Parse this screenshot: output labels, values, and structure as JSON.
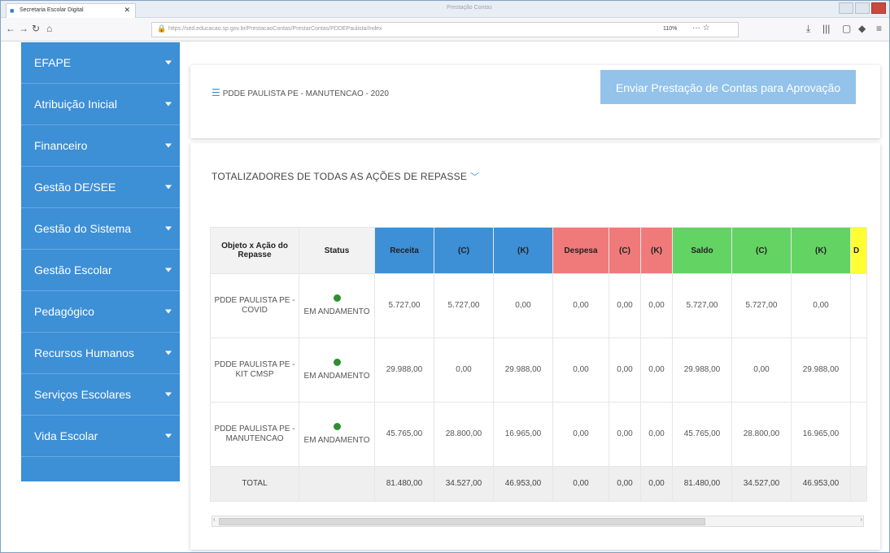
{
  "browser": {
    "tab_title": "Secretaria Escolar Digital",
    "window_title": "Prestação Contas",
    "url": "https://sed.educacao.sp.gov.br/PrestacaoContas/PrestarContas/PDDEPaulista/Index",
    "zoom": "110%"
  },
  "sidebar": {
    "items": [
      {
        "label": "EFAPE"
      },
      {
        "label": "Atribuição Inicial"
      },
      {
        "label": "Financeiro"
      },
      {
        "label": "Gestão DE/SEE"
      },
      {
        "label": "Gestão do Sistema"
      },
      {
        "label": "Gestão Escolar"
      },
      {
        "label": "Pedagógico"
      },
      {
        "label": "Recursos Humanos"
      },
      {
        "label": "Serviços Escolares"
      },
      {
        "label": "Vida Escolar"
      }
    ]
  },
  "header_card": {
    "title": "PDDE PAULISTA PE - MANUTENCAO - 2020",
    "send_button": "Enviar Prestação de Contas para Aprovação"
  },
  "totals": {
    "section_title": "TOTALIZADORES DE TODAS AS AÇÕES DE REPASSE",
    "columns": [
      "Objeto x Ação do Repasse",
      "Status",
      "Receita",
      "(C)",
      "(K)",
      "Despesa",
      "(C)",
      "(K)",
      "Saldo",
      "(C)",
      "(K)",
      "D"
    ],
    "rows": [
      {
        "objeto": "PDDE PAULISTA PE - COVID",
        "status": "EM ANDAMENTO",
        "receita": "5.727,00",
        "receita_c": "5.727,00",
        "receita_k": "0,00",
        "despesa": "0,00",
        "despesa_c": "0,00",
        "despesa_k": "0,00",
        "saldo": "5.727,00",
        "saldo_c": "5.727,00",
        "saldo_k": "0,00"
      },
      {
        "objeto": "PDDE PAULISTA PE - KIT CMSP",
        "status": "EM ANDAMENTO",
        "receita": "29.988,00",
        "receita_c": "0,00",
        "receita_k": "29.988,00",
        "despesa": "0,00",
        "despesa_c": "0,00",
        "despesa_k": "0,00",
        "saldo": "29.988,00",
        "saldo_c": "0,00",
        "saldo_k": "29.988,00"
      },
      {
        "objeto": "PDDE PAULISTA PE - MANUTENCAO",
        "status": "EM ANDAMENTO",
        "receita": "45.765,00",
        "receita_c": "28.800,00",
        "receita_k": "16.965,00",
        "despesa": "0,00",
        "despesa_c": "0,00",
        "despesa_k": "0,00",
        "saldo": "45.765,00",
        "saldo_c": "28.800,00",
        "saldo_k": "16.965,00"
      }
    ],
    "total": {
      "label": "TOTAL",
      "receita": "81.480,00",
      "receita_c": "34.527,00",
      "receita_k": "46.953,00",
      "despesa": "0,00",
      "despesa_c": "0,00",
      "despesa_k": "0,00",
      "saldo": "81.480,00",
      "saldo_c": "34.527,00",
      "saldo_k": "46.953,00"
    }
  },
  "colors": {
    "sidebar": "#3d8fd6",
    "receita": "#3d8fd6",
    "despesa": "#f07a7a",
    "saldo": "#63d363",
    "status_dot": "#2f8f2f"
  }
}
